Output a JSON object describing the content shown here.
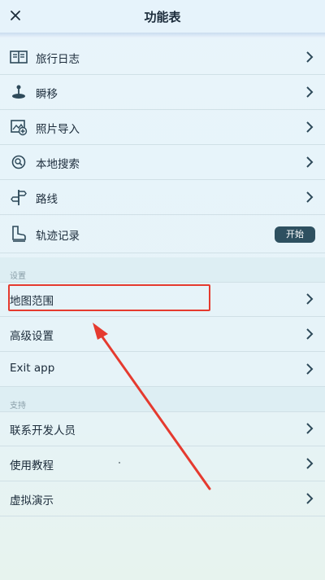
{
  "header": {
    "title": "功能表"
  },
  "menu": [
    {
      "label": "旅行日志",
      "icon": "journal-icon"
    },
    {
      "label": "瞬移",
      "icon": "joystick-icon"
    },
    {
      "label": "照片导入",
      "icon": "photo-import-icon"
    },
    {
      "label": "本地搜索",
      "icon": "local-search-icon"
    },
    {
      "label": "路线",
      "icon": "signpost-icon"
    },
    {
      "label": "轨迹记录",
      "icon": "boot-icon",
      "toggle_label": "开始"
    }
  ],
  "settings": {
    "title": "设置",
    "items": [
      {
        "label": "地图范围"
      },
      {
        "label": "高级设置"
      },
      {
        "label": "Exit app"
      }
    ]
  },
  "support": {
    "title": "支持",
    "items": [
      {
        "label": "联系开发人员"
      },
      {
        "label": "使用教程"
      },
      {
        "label": "虚拟演示"
      }
    ]
  },
  "colors": {
    "accent_button": "#2e5060",
    "annotation_red": "#e53a2f",
    "header_bg": "#e6f3fb"
  }
}
